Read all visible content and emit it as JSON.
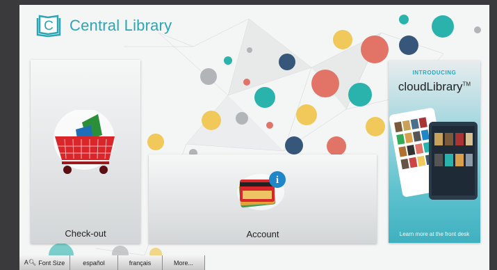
{
  "app": {
    "name": "Central Library",
    "logo_letter": "C"
  },
  "tiles": {
    "checkout": {
      "label": "Check-out",
      "icon": "shopping-cart-icon"
    },
    "account": {
      "label": "Account",
      "icon": "library-cards-icon",
      "badge": "i"
    }
  },
  "promo": {
    "intro": "INTRODUCING",
    "title": "cloudLibrary",
    "title_mark": "TM",
    "footer": "Learn more at the front desk"
  },
  "bottom_bar": {
    "font_size_label": "Font Size",
    "font_size_icon": "font-size-icon",
    "spanish_label": "español",
    "french_label": "français",
    "more_label": "More..."
  },
  "colors": {
    "accent": "#2aa6b6",
    "cart": "#d8262b",
    "badge": "#1f86c8"
  }
}
